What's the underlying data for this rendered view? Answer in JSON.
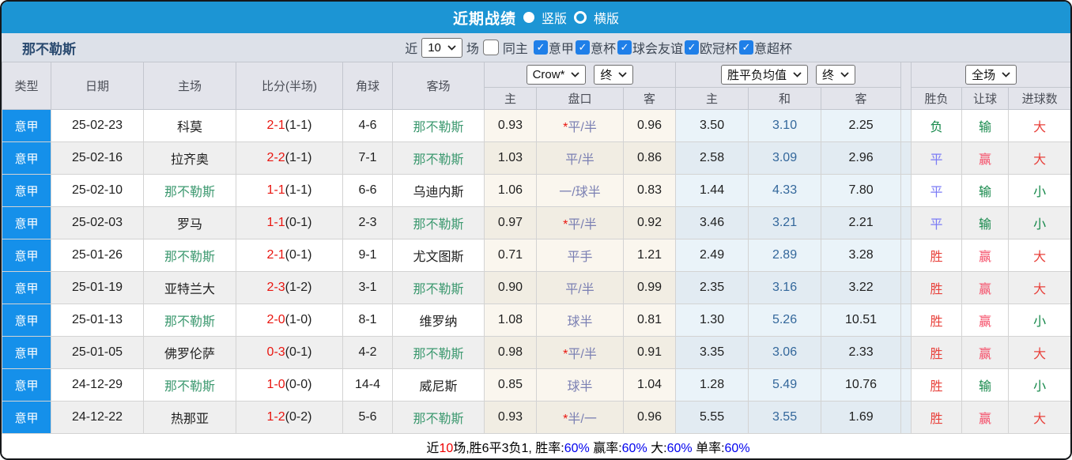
{
  "titlebar": {
    "title": "近期战绩",
    "vertical": "竖版",
    "horizontal": "横版"
  },
  "filters": {
    "team": "那不勒斯",
    "near": "近",
    "games": "场",
    "same_home": "同主",
    "leagues": [
      "意甲",
      "意杯",
      "球会友谊",
      "欧冠杯",
      "意超杯"
    ]
  },
  "selects": {
    "count": "10",
    "company": "Crow*",
    "final_a": "终",
    "avg": "胜平负均值",
    "final_b": "终",
    "scope": "全场"
  },
  "columns": {
    "type": "类型",
    "date": "日期",
    "home": "主场",
    "score": "比分(半场)",
    "corner": "角球",
    "away": "客场",
    "sub": [
      "主",
      "盘口",
      "客",
      "主",
      "和",
      "客",
      "胜负",
      "让球",
      "进球数"
    ]
  },
  "rows": [
    {
      "league": "意甲",
      "date": "25-02-23",
      "home": "科莫",
      "score": "2-1",
      "half": "(1-1)",
      "corner": "4-6",
      "away": "那不勒斯",
      "h_odds": "0.93",
      "handicap": "*平/半",
      "a_odds": "0.96",
      "avg_home": "3.50",
      "avg_draw": "3.10",
      "avg_away": "2.25",
      "result": "负",
      "handicap_result": "输",
      "goals_result": "大"
    },
    {
      "league": "意甲",
      "date": "25-02-16",
      "home": "拉齐奥",
      "score": "2-2",
      "half": "(1-1)",
      "corner": "7-1",
      "away": "那不勒斯",
      "h_odds": "1.03",
      "handicap": "平/半",
      "a_odds": "0.86",
      "avg_home": "2.58",
      "avg_draw": "3.09",
      "avg_away": "2.96",
      "result": "平",
      "handicap_result": "赢",
      "goals_result": "大"
    },
    {
      "league": "意甲",
      "date": "25-02-10",
      "home": "那不勒斯",
      "score": "1-1",
      "half": "(1-1)",
      "corner": "6-6",
      "away": "乌迪内斯",
      "h_odds": "1.06",
      "handicap": "一/球半",
      "a_odds": "0.83",
      "avg_home": "1.44",
      "avg_draw": "4.33",
      "avg_away": "7.80",
      "result": "平",
      "handicap_result": "输",
      "goals_result": "小"
    },
    {
      "league": "意甲",
      "date": "25-02-03",
      "home": "罗马",
      "score": "1-1",
      "half": "(0-1)",
      "corner": "2-3",
      "away": "那不勒斯",
      "h_odds": "0.97",
      "handicap": "*平/半",
      "a_odds": "0.92",
      "avg_home": "3.46",
      "avg_draw": "3.21",
      "avg_away": "2.21",
      "result": "平",
      "handicap_result": "输",
      "goals_result": "小"
    },
    {
      "league": "意甲",
      "date": "25-01-26",
      "home": "那不勒斯",
      "score": "2-1",
      "half": "(0-1)",
      "corner": "9-1",
      "away": "尤文图斯",
      "h_odds": "0.71",
      "handicap": "平手",
      "a_odds": "1.21",
      "avg_home": "2.49",
      "avg_draw": "2.89",
      "avg_away": "3.28",
      "result": "胜",
      "handicap_result": "赢",
      "goals_result": "大"
    },
    {
      "league": "意甲",
      "date": "25-01-19",
      "home": "亚特兰大",
      "score": "2-3",
      "half": "(1-2)",
      "corner": "3-1",
      "away": "那不勒斯",
      "h_odds": "0.90",
      "handicap": "平/半",
      "a_odds": "0.99",
      "avg_home": "2.35",
      "avg_draw": "3.16",
      "avg_away": "3.22",
      "result": "胜",
      "handicap_result": "赢",
      "goals_result": "大"
    },
    {
      "league": "意甲",
      "date": "25-01-13",
      "home": "那不勒斯",
      "score": "2-0",
      "half": "(1-0)",
      "corner": "8-1",
      "away": "维罗纳",
      "h_odds": "1.08",
      "handicap": "球半",
      "a_odds": "0.81",
      "avg_home": "1.30",
      "avg_draw": "5.26",
      "avg_away": "10.51",
      "result": "胜",
      "handicap_result": "赢",
      "goals_result": "小"
    },
    {
      "league": "意甲",
      "date": "25-01-05",
      "home": "佛罗伦萨",
      "score": "0-3",
      "half": "(0-1)",
      "corner": "4-2",
      "away": "那不勒斯",
      "h_odds": "0.98",
      "handicap": "*平/半",
      "a_odds": "0.91",
      "avg_home": "3.35",
      "avg_draw": "3.06",
      "avg_away": "2.33",
      "result": "胜",
      "handicap_result": "赢",
      "goals_result": "大"
    },
    {
      "league": "意甲",
      "date": "24-12-29",
      "home": "那不勒斯",
      "score": "1-0",
      "half": "(0-0)",
      "corner": "14-4",
      "away": "威尼斯",
      "h_odds": "0.85",
      "handicap": "球半",
      "a_odds": "1.04",
      "avg_home": "1.28",
      "avg_draw": "5.49",
      "avg_away": "10.76",
      "result": "胜",
      "handicap_result": "输",
      "goals_result": "小"
    },
    {
      "league": "意甲",
      "date": "24-12-22",
      "home": "热那亚",
      "score": "1-2",
      "half": "(0-2)",
      "corner": "5-6",
      "away": "那不勒斯",
      "h_odds": "0.93",
      "handicap": "*半/一",
      "a_odds": "0.96",
      "avg_home": "5.55",
      "avg_draw": "3.55",
      "avg_away": "1.69",
      "result": "胜",
      "handicap_result": "赢",
      "goals_result": "大"
    }
  ],
  "footer": {
    "segments": [
      {
        "text": "近",
        "color": "black"
      },
      {
        "text": "10",
        "color": "red"
      },
      {
        "text": "场,胜6平3负1, 胜率:",
        "color": "black"
      },
      {
        "text": "60%",
        "color": "blue"
      },
      {
        "text": " 赢率:",
        "color": "black"
      },
      {
        "text": "60%",
        "color": "blue"
      },
      {
        "text": " 大:",
        "color": "black"
      },
      {
        "text": "60%",
        "color": "blue"
      },
      {
        "text": " 单率:",
        "color": "black"
      },
      {
        "text": "60%",
        "color": "blue"
      }
    ]
  },
  "colors": {
    "topbar": "#1c95d4",
    "league_cell": "#1590ea",
    "checkbox": "#1f7fe8",
    "win_red": "#e8423c",
    "draw_blue": "#7b7bf5",
    "lose_green": "#15884a",
    "team_green": "#3d9970",
    "score_red": "#e9150f"
  }
}
